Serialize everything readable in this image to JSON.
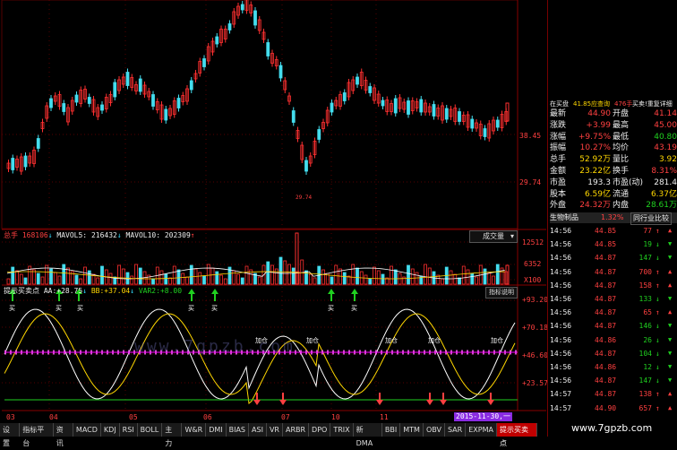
{
  "colors": {
    "up": "#ff3030",
    "down": "#44ddee",
    "bg": "#000000",
    "grid": "#550000",
    "accent_purple": "#8a2be2"
  },
  "main_chart": {
    "price_ticks": [
      "38.45",
      "29.74"
    ],
    "low_marker": "29.74"
  },
  "volume_panel": {
    "title": "总手",
    "total": "168106",
    "mavol5_label": "MAVOL5:",
    "mavol5": "216432",
    "mavol10_label": "MAVOL10:",
    "mavol10": "202309",
    "dropdown": "成交量",
    "ticks": [
      "12512",
      "6352",
      "X100"
    ]
  },
  "indicator_panel": {
    "title": "提示买卖点",
    "aa_label": "AA:",
    "aa": "+28.75",
    "bb_label": "BB:",
    "bb": "+37.04",
    "var2_label": "VAR2:",
    "var2": "+8.00",
    "help_button": "指标说明",
    "ticks": [
      "+93.20",
      "+70.18",
      "+46.60",
      "+23.57"
    ],
    "signal_buy": "买",
    "signal_add": "加仓",
    "watermark": "www.7gpzb.com"
  },
  "date_axis": {
    "labels": [
      "03",
      "04",
      "05",
      "06",
      "07",
      "10",
      "11"
    ],
    "highlight": "2015-11-30,一"
  },
  "tabs": [
    "设置",
    "指标平台",
    "资讯",
    "MACD",
    "KDJ",
    "RSI",
    "BOLL",
    "主力",
    "W&R",
    "DMI",
    "BIAS",
    "ASI",
    "VR",
    "ARBR",
    "DPO",
    "TRIX",
    "新DMA",
    "BBI",
    "MTM",
    "OBV",
    "SAR",
    "EXPMA",
    "提示买卖点"
  ],
  "active_tab": "提示买卖点",
  "quote_panel": {
    "header_left": "在买盘",
    "header_val": "41.85应查询",
    "header_vol": "476手",
    "header_right": "买卖!重复详细",
    "rows": [
      {
        "l1": "最新",
        "v1": "44.90",
        "l2": "开盘",
        "v2": "41.14"
      },
      {
        "l1": "涨跌",
        "v1": "+3.99",
        "l2": "最高",
        "v2": "45.00"
      },
      {
        "l1": "涨幅",
        "v1": "+9.75%",
        "l2": "最低",
        "v2": "40.80"
      },
      {
        "l1": "振幅",
        "v1": "10.27%",
        "l2": "均价",
        "v2": "43.19"
      },
      {
        "l1": "总手",
        "v1": "52.92万",
        "l2": "量比",
        "v2": "3.92"
      },
      {
        "l1": "金额",
        "v1": "23.22亿",
        "l2": "换手",
        "v2": "8.31%"
      },
      {
        "l1": "市盈",
        "v1": "193.3",
        "l2": "市盈(动)",
        "v2": "281.4"
      },
      {
        "l1": "股本",
        "v1": "6.59亿",
        "l2": "流通",
        "v2": "6.37亿"
      },
      {
        "l1": "外盘",
        "v1": "24.32万",
        "l2": "内盘",
        "v2": "28.61万"
      }
    ],
    "sector": "生物制品",
    "sector_pct": "1.32%",
    "sector_compare": "同行业比较",
    "trades": [
      {
        "t": "14:56",
        "p": "44.85",
        "v": "77",
        "d": "↑"
      },
      {
        "t": "14:56",
        "p": "44.85",
        "v": "19",
        "d": "↓"
      },
      {
        "t": "14:56",
        "p": "44.87",
        "v": "147",
        "d": "↓"
      },
      {
        "t": "14:56",
        "p": "44.87",
        "v": "700",
        "d": "↑"
      },
      {
        "t": "14:56",
        "p": "44.87",
        "v": "158",
        "d": "↑"
      },
      {
        "t": "14:56",
        "p": "44.87",
        "v": "133",
        "d": "↓"
      },
      {
        "t": "14:56",
        "p": "44.87",
        "v": "65",
        "d": "↑"
      },
      {
        "t": "14:56",
        "p": "44.87",
        "v": "146",
        "d": "↓"
      },
      {
        "t": "14:56",
        "p": "44.86",
        "v": "26",
        "d": "↓"
      },
      {
        "t": "14:56",
        "p": "44.87",
        "v": "104",
        "d": "↓"
      },
      {
        "t": "14:56",
        "p": "44.86",
        "v": "12",
        "d": "↓"
      },
      {
        "t": "14:56",
        "p": "44.87",
        "v": "147",
        "d": "↓"
      },
      {
        "t": "14:57",
        "p": "44.87",
        "v": "138",
        "d": "↑"
      },
      {
        "t": "14:57",
        "p": "44.90",
        "v": "657",
        "d": "↑"
      }
    ],
    "brand": "www.7gpzb.com"
  }
}
